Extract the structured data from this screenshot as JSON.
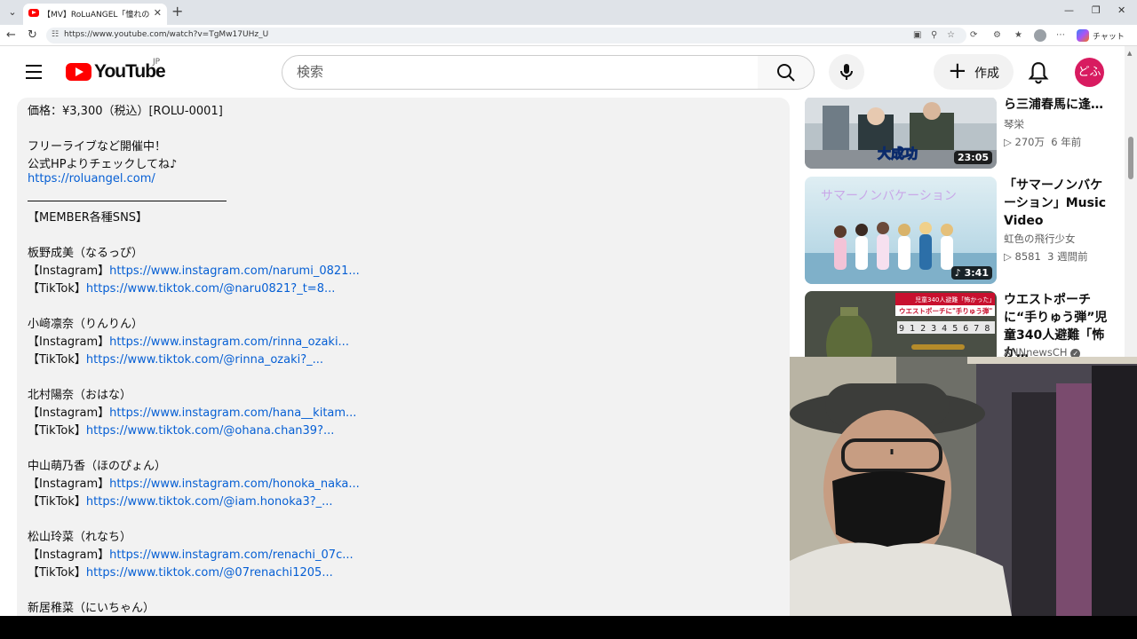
{
  "browser": {
    "tab_title": "【MV】RoLuANGEL「憧れの日Ye!!」",
    "url": "https://www.youtube.com/watch?v=TgMw17UHz_U",
    "copilot_label": "チャット"
  },
  "youtube": {
    "logo_text": "YouTube",
    "region": "JP",
    "search_placeholder": "検索",
    "create_label": "作成",
    "avatar_text": "どふ"
  },
  "description": {
    "price": "価格：¥3,300（税込）[ROLU-0001]",
    "live_line": "フリーライブなど開催中！",
    "hp_line": "公式HPよりチェックしてね♪",
    "hp_url": "https://roluangel.com/",
    "sns_header": "【MEMBER各種SNS】",
    "ig_prefix": "【Instagram】",
    "tt_prefix": "【TikTok】",
    "members": [
      {
        "name": "板野成美（なるっぴ）",
        "instagram": "https://www.instagram.com/narumi_0821...",
        "tiktok": "https://www.tiktok.com/@naru0821?_t=8..."
      },
      {
        "name": "小﨑凛奈（りんりん）",
        "instagram": "https://www.instagram.com/rinna_ozaki...",
        "tiktok": "https://www.tiktok.com/@rinna_ozaki?_..."
      },
      {
        "name": "北村陽奈（おはな）",
        "instagram": "https://www.instagram.com/hana__kitam...",
        "tiktok": "https://www.tiktok.com/@ohana.chan39?..."
      },
      {
        "name": "中山萌乃香（ほのぴょん）",
        "instagram": "https://www.instagram.com/honoka_naka...",
        "tiktok": "https://www.tiktok.com/@iam.honoka3?_..."
      },
      {
        "name": "松山玲菜（れなち）",
        "instagram": "https://www.instagram.com/renachi_07c...",
        "tiktok": "https://www.tiktok.com/@07renachi1205..."
      },
      {
        "name": "新居稚菜（にいちゃん）",
        "instagram": "",
        "tiktok": ""
      }
    ]
  },
  "related": [
    {
      "title": "ら三浦春馬に逢…",
      "channel": "琴栄",
      "views": "270万",
      "age": "6 年前",
      "duration": "23:05",
      "thumb_caption": "大成功"
    },
    {
      "title": "「サマーノンバケーション」Music Video",
      "channel": "虹色の飛行少女",
      "views": "8581",
      "age": "3 週間前",
      "duration": "3:41",
      "thumb_caption": "サマーノンバケーション"
    },
    {
      "title": "ウエストポーチに“手りゅう弾”児童340人避難「怖か…",
      "channel": "ANNnewsCH",
      "views": "",
      "age": "",
      "duration": "",
      "thumb_caption": "ウエストポーチに\"手りゅう弾\"",
      "thumb_subcaption": "児童340人避難「怖かった」"
    }
  ]
}
